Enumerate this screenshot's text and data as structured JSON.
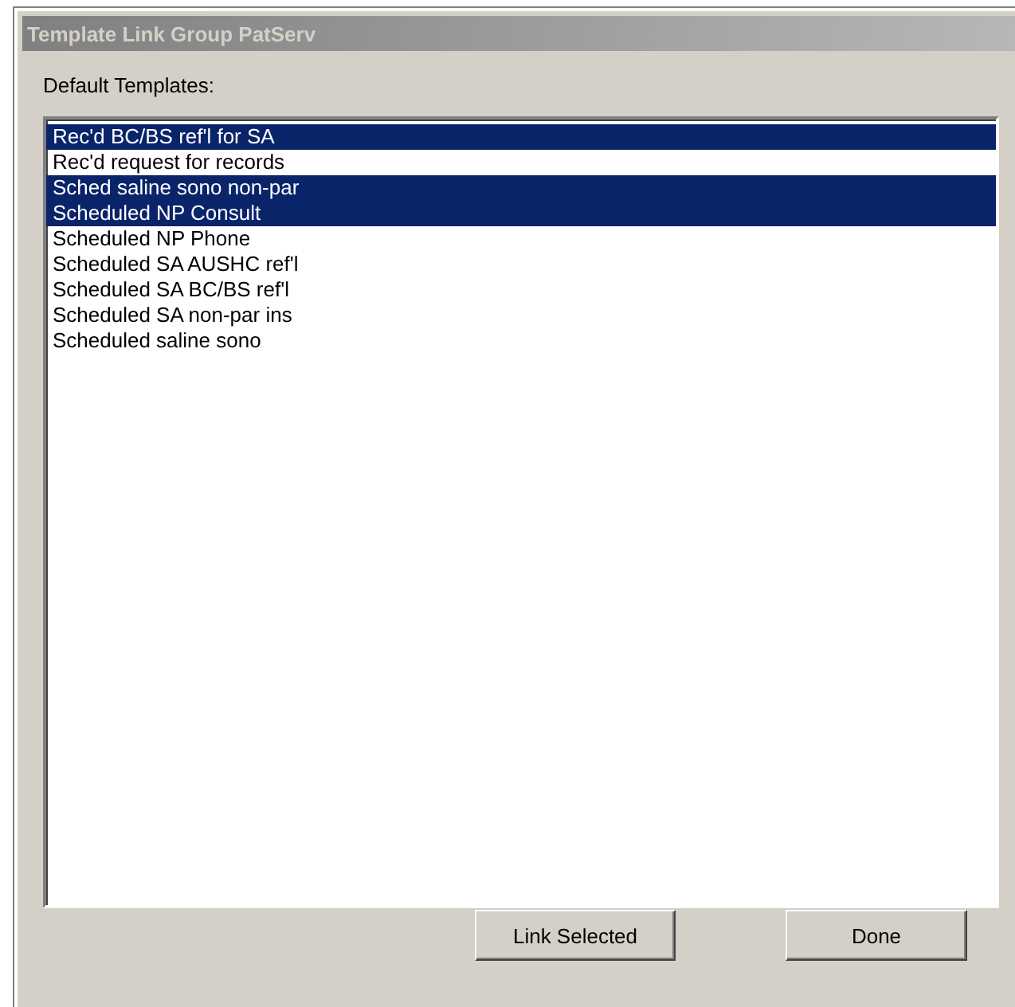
{
  "window": {
    "title": "Template Link Group PatServ"
  },
  "label": "Default Templates:",
  "templates": [
    {
      "text": "Rec'd BC/BS ref'l for SA",
      "selected": true
    },
    {
      "text": "Rec'd request for records",
      "selected": false
    },
    {
      "text": "Sched saline sono non-par",
      "selected": true
    },
    {
      "text": "Scheduled NP Consult",
      "selected": true
    },
    {
      "text": "Scheduled NP Phone",
      "selected": false
    },
    {
      "text": "Scheduled SA AUSHC ref'l",
      "selected": false
    },
    {
      "text": "Scheduled SA BC/BS ref'l",
      "selected": false
    },
    {
      "text": "Scheduled SA non-par ins",
      "selected": false
    },
    {
      "text": "Scheduled saline sono",
      "selected": false
    }
  ],
  "buttons": [
    "Link Selected",
    "Done"
  ]
}
